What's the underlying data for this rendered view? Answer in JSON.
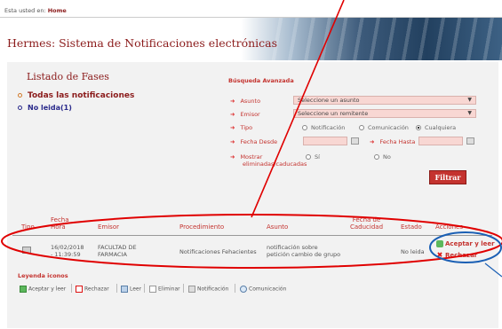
{
  "breadcrumb": {
    "prefix": "Esta usted en:",
    "home": "Home"
  },
  "app": {
    "title": "Hermes: Sistema de Notificaciones electrónicas"
  },
  "fases": {
    "title": "Listado de Fases",
    "items": [
      {
        "label": "Todas las notificaciones"
      },
      {
        "label": "No leida(1)"
      }
    ]
  },
  "busqueda": {
    "title": "Búsqueda Avanzada",
    "asunto_label": "Asunto",
    "asunto_value": "Seleccione un asunto",
    "emisor_label": "Emisor",
    "emisor_value": "Seleccione un remitente",
    "tipo_label": "Tipo",
    "tipo_options": [
      "Notificación",
      "Comunicación",
      "Cualquiera"
    ],
    "tipo_selected": "Cualquiera",
    "fecha_desde_label": "Fecha Desde",
    "fecha_hasta_label": "Fecha Hasta",
    "mostrar_label": "Mostrar",
    "mostrar_label_2": "eliminadas/caducadas",
    "mostrar_options": [
      "Sí",
      "No"
    ],
    "filtrar_label": "Filtrar"
  },
  "table": {
    "headers": {
      "tipo": "Tipo",
      "fecha_1": "Fecha",
      "fecha_2": "Hora",
      "emisor": "Emisor",
      "procedimiento": "Procedimiento",
      "asunto": "Asunto",
      "caducidad_1": "Fecha de",
      "caducidad_2": "Caducidad",
      "estado": "Estado",
      "acciones": "Acciones"
    },
    "row": {
      "fecha_1": "16/02/2018",
      "fecha_2": "- 11:39:59",
      "emisor_1": "FACULTAD DE",
      "emisor_2": "FARMACIA",
      "procedimiento": "Notificaciones Fehacientes",
      "asunto_1": "notificación sobre",
      "asunto_2": "petición cambio de grupo",
      "estado": "No leida",
      "accion_aceptar": "Aceptar y leer",
      "accion_rechazar": "Rechazar"
    }
  },
  "leyenda": {
    "title": "Leyenda iconos",
    "items": [
      "Aceptar y leer",
      "Rechazar",
      "Leer",
      "Eliminar",
      "Notificación",
      "Comunicación"
    ]
  },
  "colors": {
    "accent": "#c4332f",
    "title": "#8b1b1b",
    "annotation_red": "#e00000",
    "annotation_blue": "#1a5fb4"
  }
}
